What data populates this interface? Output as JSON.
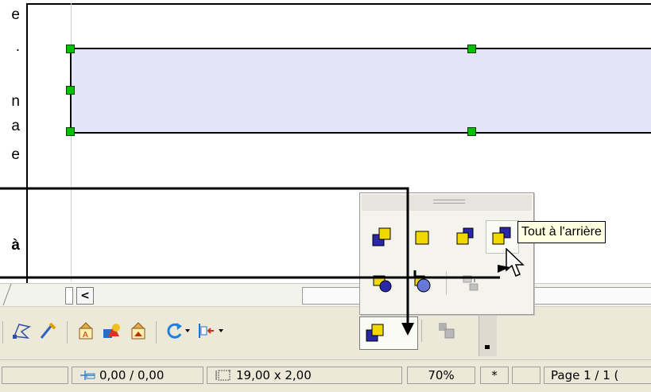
{
  "left_text": {
    "line1_end": "e",
    "line2_end": ".",
    "line3_end": "n",
    "line4_end": "a",
    "line5_end": "e",
    "line6_end": "à"
  },
  "palette": {
    "tooltip": "Tout à l'arrière",
    "items": [
      {
        "icon": "bring-to-front-icon",
        "tooltip": ""
      },
      {
        "icon": "bring-forward-icon",
        "tooltip": ""
      },
      {
        "icon": "send-backward-icon",
        "tooltip": ""
      },
      {
        "icon": "send-to-back-icon",
        "tooltip": "Tout à l'arrière"
      },
      {
        "icon": "in-front-of-object-icon",
        "tooltip": ""
      },
      {
        "icon": "behind-object-icon",
        "tooltip": ""
      },
      {
        "icon": "reverse-icon",
        "tooltip": ""
      }
    ]
  },
  "scrollbar": {
    "left_arrow": "<"
  },
  "toolbar": {
    "items": [
      "points-icon",
      "fontwork-icon",
      "text-align-top-icon",
      "shapes-icon",
      "text-align-bottom-icon",
      "rotate-icon",
      "alignment-icon",
      "arrange-icon",
      "group-icon"
    ]
  },
  "statusbar": {
    "position": "0,00 / 0,00",
    "size": "19,00 x 2,00",
    "zoom": "70%",
    "modified": "*",
    "page": "Page 1 / 1 ("
  },
  "colors": {
    "shape_fill": "#e4e4f8",
    "handle": "#00c000",
    "front_square": "#f0d800",
    "back_square": "#2828a8",
    "tooltip_bg": "#ffffe1",
    "toolbar_bg": "#ece9d8"
  }
}
